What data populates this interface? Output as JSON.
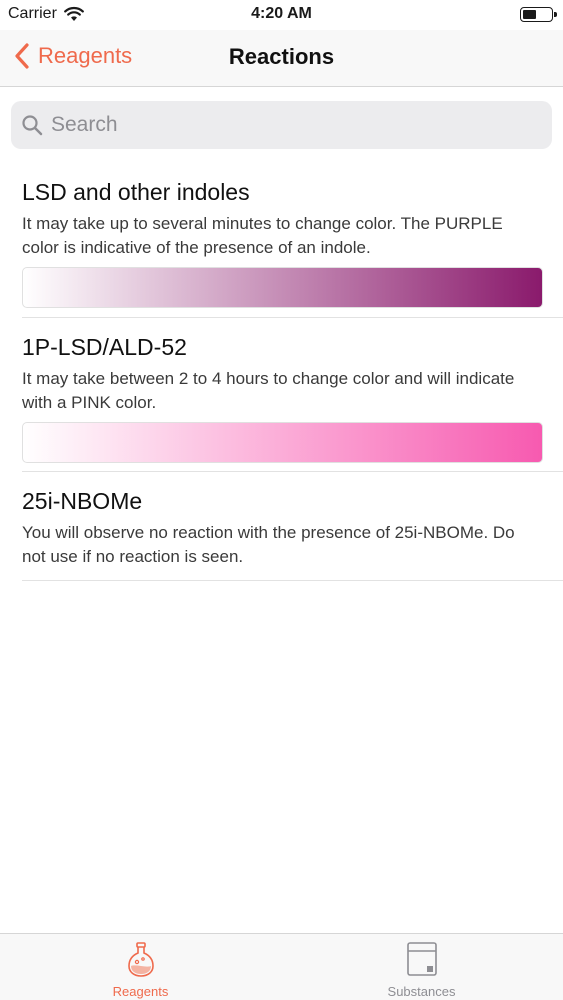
{
  "status_bar": {
    "carrier": "Carrier",
    "time": "4:20 AM"
  },
  "nav": {
    "back_label": "Reagents",
    "title": "Reactions"
  },
  "search": {
    "placeholder": "Search"
  },
  "reactions": [
    {
      "title": "LSD and other indoles",
      "description": "It may take up to several minutes to change color. The PURPLE color is indicative of the presence of an indole.",
      "gradient": {
        "from": "#ffffff",
        "to": "#8a1a6c"
      }
    },
    {
      "title": "1P-LSD/ALD-52",
      "description": "It may take between 2 to 4 hours to change color and will indicate with a PINK color.",
      "gradient": {
        "from": "#ffffff",
        "to": "#f75ab0"
      }
    },
    {
      "title": "25i-NBOMe",
      "description": "You will observe no reaction with the presence of 25i-NBOMe. Do not use if no reaction is seen."
    }
  ],
  "tabs": [
    {
      "label": "Reagents",
      "icon": "flask-icon",
      "active": true
    },
    {
      "label": "Substances",
      "icon": "substances-icon",
      "active": false
    }
  ],
  "colors": {
    "accent": "#ef6a4c",
    "inactive": "#8e8e93"
  }
}
